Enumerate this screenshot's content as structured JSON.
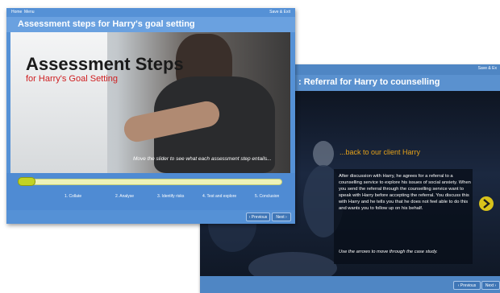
{
  "window_back": {
    "save_exit": "Save & Ex",
    "title": ": Referral for Harry to counselling",
    "heading": "...back to our client Harry",
    "paragraph": "After discussion with Harry, he agrees for a referral to a counselling service to explore his issues of social anxiety. When you send the referral through the counselling service want to speak with Harry before accepting the referral. You discuss this with Harry and he tells you that he does not feel able to do this and wants you to follow up on his behalf.",
    "hint": "Use the arrows to move through the case study.",
    "previous_label": "‹ Previous",
    "next_label": "Next ›"
  },
  "window_front": {
    "nav": {
      "home": "Home",
      "menu": "Menu",
      "save_exit": "Save & Exit"
    },
    "title": "Assessment steps for Harry's goal setting",
    "banner_title": "Assessment Steps",
    "banner_subtitle": "for Harry's Goal Setting",
    "hint": "Move the slider to see what each assessment step entails...",
    "slider_progress": 0.04,
    "steps": [
      "1. Collate",
      "2. Analyse",
      "3. Identify risks",
      "4. Test and explore",
      "5. Conclusion"
    ],
    "previous_label": "‹ Previous",
    "next_label": "Next ›"
  },
  "colors": {
    "accent_yellow": "#d9c21b",
    "heading_orange": "#e5a21a",
    "subtitle_red": "#cf1e20",
    "frame_blue": "#5591d6"
  },
  "icons": [
    "chevron-right-icon"
  ]
}
